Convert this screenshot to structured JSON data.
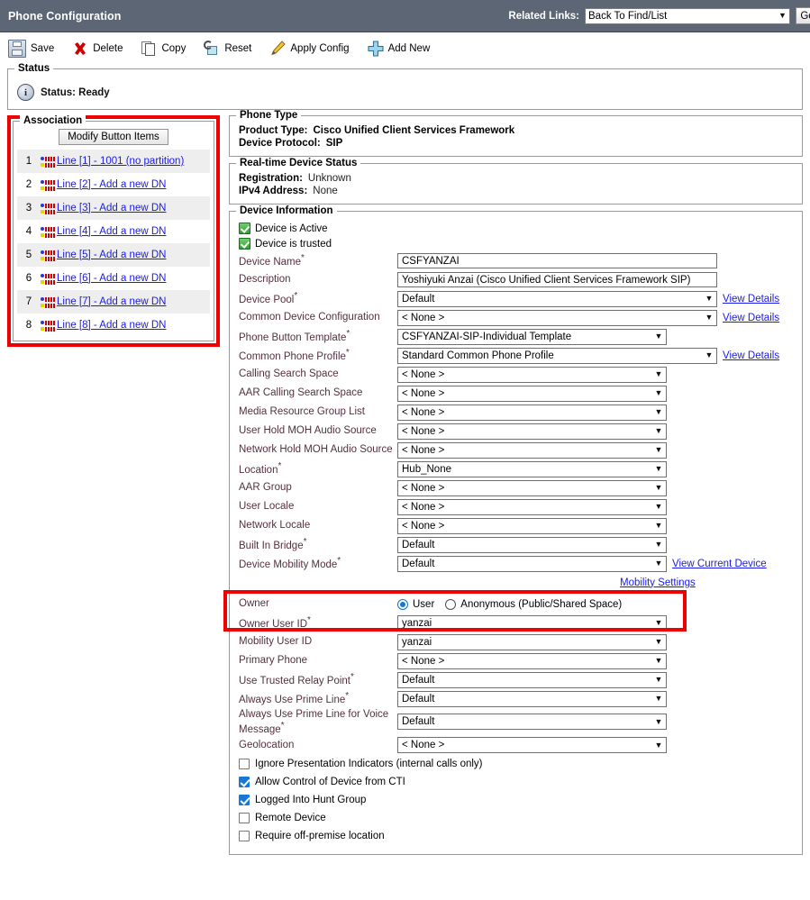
{
  "header": {
    "title": "Phone Configuration",
    "related_links_label": "Related Links:",
    "related_links_value": "Back To Find/List",
    "go_label": "Go",
    "bar_color": "#5d6675"
  },
  "toolbar": {
    "items": [
      {
        "label": "Save",
        "icon": "save-icon"
      },
      {
        "label": "Delete",
        "icon": "delete-icon"
      },
      {
        "label": "Copy",
        "icon": "copy-icon"
      },
      {
        "label": "Reset",
        "icon": "reset-icon"
      },
      {
        "label": "Apply Config",
        "icon": "pencil-icon"
      },
      {
        "label": "Add New",
        "icon": "plus-icon"
      }
    ]
  },
  "status": {
    "legend": "Status",
    "icon": "info-icon",
    "text": "Status: Ready"
  },
  "association": {
    "legend": "Association",
    "modify_button": "Modify Button Items",
    "highlight_color": "#ee0000",
    "rows": [
      {
        "num": "1",
        "label": "Line [1] - 1001 (no partition)"
      },
      {
        "num": "2",
        "label": "Line [2] - Add a new DN"
      },
      {
        "num": "3",
        "label": "Line [3] - Add a new DN"
      },
      {
        "num": "4",
        "label": "Line [4] - Add a new DN"
      },
      {
        "num": "5",
        "label": "Line [5] - Add a new DN"
      },
      {
        "num": "6",
        "label": "Line [6] - Add a new DN"
      },
      {
        "num": "7",
        "label": "Line [7] - Add a new DN"
      },
      {
        "num": "8",
        "label": "Line [8] - Add a new DN"
      }
    ]
  },
  "phone_type": {
    "legend": "Phone Type",
    "product_type_label": "Product Type:",
    "product_type_value": "Cisco Unified Client Services Framework",
    "device_protocol_label": "Device Protocol:",
    "device_protocol_value": "SIP"
  },
  "device_status": {
    "legend": "Real-time Device Status",
    "registration_label": "Registration:",
    "registration_value": "Unknown",
    "ipv4_label": "IPv4 Address:",
    "ipv4_value": "None"
  },
  "device_info": {
    "legend": "Device Information",
    "device_active_label": "Device is Active",
    "device_trusted_label": "Device is trusted",
    "fields": [
      {
        "label": "Device Name",
        "required": true,
        "type": "text",
        "value": "CSFYANZAI",
        "width": "wide",
        "link": ""
      },
      {
        "label": "Description",
        "required": false,
        "type": "text",
        "value": "Yoshiyuki Anzai (Cisco Unified Client Services Framework SIP)",
        "width": "wide",
        "link": ""
      },
      {
        "label": "Device Pool",
        "required": true,
        "type": "select",
        "value": "Default",
        "width": "wide",
        "link": "View Details"
      },
      {
        "label": "Common Device Configuration",
        "required": false,
        "type": "select",
        "value": "< None >",
        "width": "wide",
        "link": "View Details"
      },
      {
        "label": "Phone Button Template",
        "required": true,
        "type": "select",
        "value": "CSFYANZAI-SIP-Individual Template",
        "width": "narrow",
        "link": ""
      },
      {
        "label": "Common Phone Profile",
        "required": true,
        "type": "select",
        "value": "Standard Common Phone Profile",
        "width": "wide",
        "link": "View Details"
      },
      {
        "label": "Calling Search Space",
        "required": false,
        "type": "select",
        "value": "< None >",
        "width": "narrow",
        "link": ""
      },
      {
        "label": "AAR Calling Search Space",
        "required": false,
        "type": "select",
        "value": "< None >",
        "width": "narrow",
        "link": ""
      },
      {
        "label": "Media Resource Group List",
        "required": false,
        "type": "select",
        "value": "< None >",
        "width": "narrow",
        "link": ""
      },
      {
        "label": "User Hold MOH Audio Source",
        "required": false,
        "type": "select",
        "value": "< None >",
        "width": "narrow",
        "link": ""
      },
      {
        "label": "Network Hold MOH Audio Source",
        "required": false,
        "type": "select",
        "value": "< None >",
        "width": "narrow",
        "link": ""
      },
      {
        "label": "Location",
        "required": true,
        "type": "select",
        "value": "Hub_None",
        "width": "narrow",
        "link": ""
      },
      {
        "label": "AAR Group",
        "required": false,
        "type": "select",
        "value": "< None >",
        "width": "narrow",
        "link": ""
      },
      {
        "label": "User Locale",
        "required": false,
        "type": "select",
        "value": "< None >",
        "width": "narrow",
        "link": ""
      },
      {
        "label": "Network Locale",
        "required": false,
        "type": "select",
        "value": "< None >",
        "width": "narrow",
        "link": ""
      },
      {
        "label": "Built In Bridge",
        "required": true,
        "type": "select",
        "value": "Default",
        "width": "narrow",
        "link": ""
      },
      {
        "label": "Device Mobility Mode",
        "required": true,
        "type": "select",
        "value": "Default",
        "width": "narrow",
        "link": "View Current Device"
      }
    ],
    "mobility_settings_link": "Mobility Settings",
    "owner": {
      "label": "Owner",
      "user_option": "User",
      "anonymous_option": "Anonymous (Public/Shared Space)",
      "selected": "User",
      "user_id_label": "Owner User ID",
      "user_id_required": true,
      "user_id_value": "yanzai",
      "highlight_color": "#ee0000"
    },
    "fields_after": [
      {
        "label": "Mobility User ID",
        "required": false,
        "type": "select",
        "value": "yanzai",
        "width": "narrow",
        "link": ""
      },
      {
        "label": "Primary Phone",
        "required": false,
        "type": "select",
        "value": "< None >",
        "width": "narrow",
        "link": ""
      },
      {
        "label": "Use Trusted Relay Point",
        "required": true,
        "type": "select",
        "value": "Default",
        "width": "narrow",
        "link": ""
      },
      {
        "label": "Always Use Prime Line",
        "required": true,
        "type": "select",
        "value": "Default",
        "width": "narrow",
        "link": ""
      },
      {
        "label": "Always Use Prime Line for Voice Message",
        "required": true,
        "type": "select",
        "value": "Default",
        "width": "narrow",
        "link": ""
      },
      {
        "label": "Geolocation",
        "required": false,
        "type": "select",
        "value": "< None >",
        "width": "narrow",
        "link": ""
      }
    ],
    "checkboxes": [
      {
        "label": "Ignore Presentation Indicators (internal calls only)",
        "checked": false
      },
      {
        "label": "Allow Control of Device from CTI",
        "checked": true
      },
      {
        "label": "Logged Into Hunt Group",
        "checked": true
      },
      {
        "label": "Remote Device",
        "checked": false
      },
      {
        "label": "Require off-premise location",
        "checked": false
      }
    ]
  }
}
